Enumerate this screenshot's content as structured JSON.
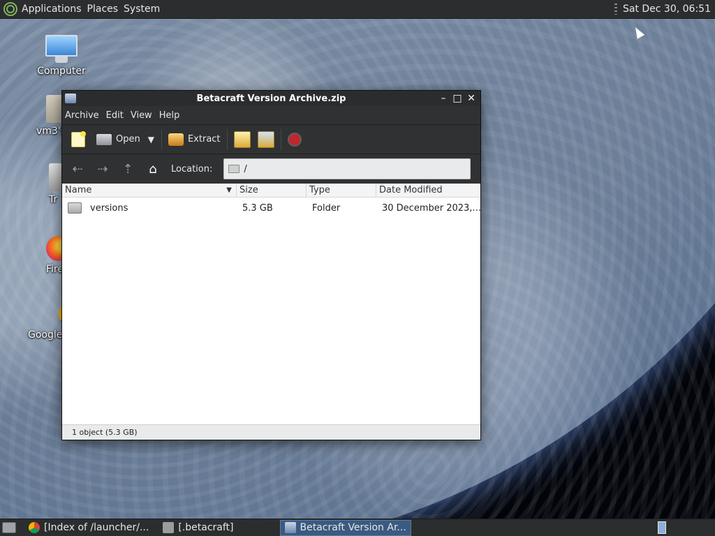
{
  "top_panel": {
    "menus": [
      "Applications",
      "Places",
      "System"
    ],
    "clock": "Sat Dec 30, 06:51"
  },
  "desktop_icons": [
    {
      "label": "Computer",
      "icon": "computer-icon"
    },
    {
      "label": "vm3's",
      "icon": "home-folder-icon"
    },
    {
      "label": "Tr",
      "icon": "trash-icon"
    },
    {
      "label": "Fire",
      "icon": "firefox-icon"
    },
    {
      "label": "Google",
      "icon": "chrome-icon"
    }
  ],
  "window": {
    "title": "Betacraft Version Archive.zip",
    "menus": [
      "Archive",
      "Edit",
      "View",
      "Help"
    ],
    "toolbar": {
      "open_label": "Open",
      "extract_label": "Extract"
    },
    "location": {
      "label": "Location:",
      "value": "/"
    },
    "columns": {
      "name": "Name",
      "size": "Size",
      "type": "Type",
      "date": "Date Modified"
    },
    "rows": [
      {
        "name": "versions",
        "size": "5.3 GB",
        "type": "Folder",
        "date": "30 December 2023,..."
      }
    ],
    "status": "1 object (5.3 GB)"
  },
  "taskbar": {
    "tasks": [
      {
        "label": "[Index of /launcher/...",
        "icon": "chrome-icon",
        "active": false
      },
      {
        "label": "[.betacraft]",
        "icon": "folder-icon",
        "active": false
      },
      {
        "label": "Betacraft Version Ar...",
        "icon": "archive-icon",
        "active": true
      }
    ]
  },
  "colors": {
    "panel_bg": "#2b2d2e",
    "window_bg": "#2f3133",
    "active_task": "#3a5a80",
    "stop_button": "#c0262d"
  }
}
